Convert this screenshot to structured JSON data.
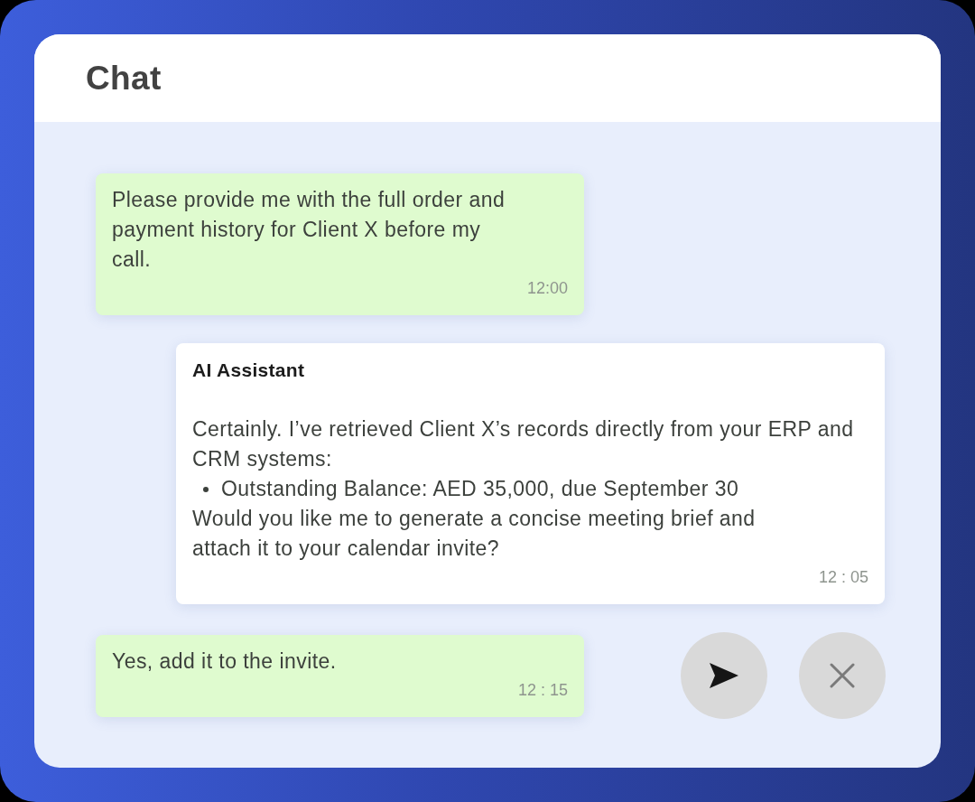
{
  "header": {
    "title": "Chat"
  },
  "messages": [
    {
      "kind": "user",
      "text": "Please provide me with the full order and payment history for Client X before my call.",
      "time": "12:00"
    },
    {
      "kind": "assistant",
      "sender": "AI Assistant",
      "intro": "Certainly. I’ve retrieved Client X’s records directly from your ERP and CRM systems:",
      "bullets": [
        "Outstanding Balance: AED 35,000, due September 30"
      ],
      "closing": "Would you like me to generate a concise meeting brief and attach it to your calendar invite?",
      "time": "12 : 05"
    },
    {
      "kind": "user",
      "text": "Yes, add it to the invite.",
      "time": "12 : 15"
    }
  ],
  "actions": [
    {
      "kind": "send"
    },
    {
      "kind": "close"
    }
  ]
}
